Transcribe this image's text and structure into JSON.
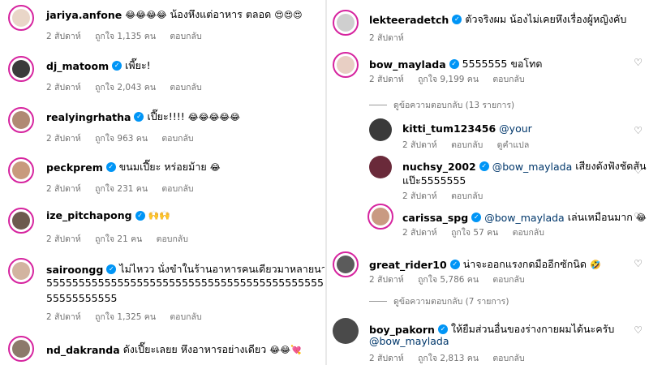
{
  "left": [
    {
      "user": "jariya.anfone",
      "verified": false,
      "text": "น้องหึงแต่อาหาร ตลอด",
      "emoji_before": "😂😂😂😂",
      "emoji_after": "😍😍😍",
      "time": "2 สัปดาห์",
      "likes": "ถูกใจ 1,135 คน",
      "reply": "ตอบกลับ"
    },
    {
      "user": "dj_matoom",
      "verified": true,
      "text": "เพี๊ยะ!",
      "time": "2 สัปดาห์",
      "likes": "ถูกใจ 2,043 คน",
      "reply": "ตอบกลับ"
    },
    {
      "user": "realyingrhatha",
      "verified": true,
      "text": "เปี๊ยะ!!!!",
      "emoji_after": "😂😂😂😂😂",
      "time": "2 สัปดาห์",
      "likes": "ถูกใจ 963 คน",
      "reply": "ตอบกลับ"
    },
    {
      "user": "peckprem",
      "verified": true,
      "text": "ขนมเปี๊ยะ หร่อยม้าย",
      "emoji_after": "😂",
      "time": "2 สัปดาห์",
      "likes": "ถูกใจ 231 คน",
      "reply": "ตอบกลับ"
    },
    {
      "user": "ize_pitchapong",
      "verified": true,
      "text": "",
      "emoji_after": "🙌🙌",
      "time": "2 สัปดาห์",
      "likes": "ถูกใจ 21 คน",
      "reply": "ตอบกลับ"
    },
    {
      "user": "sairoongg",
      "verified": true,
      "text": "ไม่ไหวว นั่งขำในร้านอาหารคนเดียวมาหลายนาทีล",
      "line2": "55555555555555555555555555555555555555555555555",
      "line3": "55555555555",
      "time": "2 สัปดาห์",
      "likes": "ถูกใจ 1,325 คน",
      "reply": "ตอบกลับ"
    },
    {
      "user": "nd_dakranda",
      "verified": false,
      "text": "ดังเปี๊ยะเลยย หึงอาหารอย่างเดียว",
      "emoji_after": "😂😂💘"
    }
  ],
  "right": {
    "c1": {
      "user": "lekteeradetch",
      "verified": true,
      "text": "ตัวจริงผม น้องไม่เคยหึงเรื่องผู้หญิงคับ",
      "time": "2 สัปดาห์"
    },
    "c2": {
      "user": "bow_maylada",
      "verified": true,
      "text": "5555555 ขอโทด",
      "time": "2 สัปดาห์",
      "likes": "ถูกใจ 9,199 คน",
      "reply": "ตอบกลับ"
    },
    "view1": "ดูข้อความตอบกลับ (13 รายการ)",
    "r1": {
      "user": "kitti_tum123456",
      "mention": "@your",
      "time": "2 สัปดาห์",
      "reply": "ตอบกลับ",
      "translate": "ดูคำแปล"
    },
    "r2": {
      "user": "nuchsy_2002",
      "verified": true,
      "mention": "@bow_maylada",
      "text": "เสียงดังฟังชัดสัน",
      "line2": "แป๊ะ5555555",
      "time": "2 สัปดาห์",
      "reply": "ตอบกลับ"
    },
    "r3": {
      "user": "carissa_spg",
      "verified": true,
      "mention": "@bow_maylada",
      "text": "เล่นเหมือนมาก",
      "emoji_after": "😂",
      "time": "2 สัปดาห์",
      "likes": "ถูกใจ 57 คน",
      "reply": "ตอบกลับ"
    },
    "c3": {
      "user": "great_rider10",
      "verified": true,
      "text": "น่าจะออกแรงกดมืออีกซักนิด",
      "emoji_after": "🤣",
      "time": "2 สัปดาห์",
      "likes": "ถูกใจ 5,786 คน",
      "reply": "ตอบกลับ"
    },
    "view2": "ดูข้อความตอบกลับ (7 รายการ)",
    "c4": {
      "user": "boy_pakorn",
      "verified": true,
      "text": "ให้ยืมส่วนอื่นของร่างกายผมได้นะครับ",
      "line2": "@bow_maylada",
      "time": "2 สัปดาห์",
      "likes": "ถูกใจ 2,813 คน",
      "reply": "ตอบกลับ"
    }
  },
  "icons": {
    "verified": "verified-badge",
    "heart": "heart-outline-icon"
  },
  "colors": {
    "verified": "#0095f6",
    "ring": "#d6249f",
    "meta": "#737373",
    "link": "#00376b"
  }
}
